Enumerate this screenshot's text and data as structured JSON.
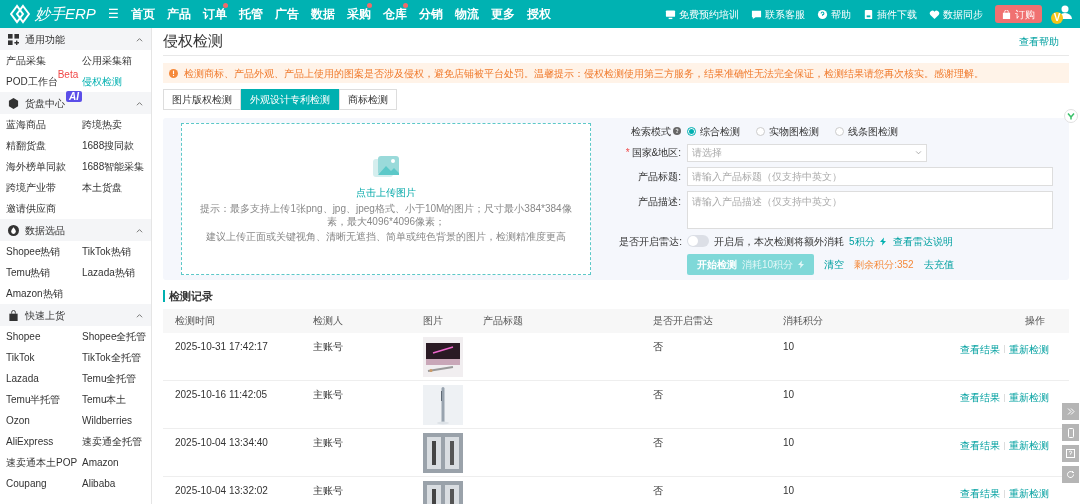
{
  "topbar": {
    "logo": "妙手ERP",
    "menu_icon": "☰",
    "nav": [
      {
        "label": "首页",
        "dot": false
      },
      {
        "label": "产品",
        "dot": false
      },
      {
        "label": "订单",
        "dot": true
      },
      {
        "label": "托管",
        "dot": false
      },
      {
        "label": "广告",
        "dot": false
      },
      {
        "label": "数据",
        "dot": false
      },
      {
        "label": "采购",
        "dot": true
      },
      {
        "label": "仓库",
        "dot": true
      },
      {
        "label": "分销",
        "dot": false
      },
      {
        "label": "物流",
        "dot": false
      },
      {
        "label": "更多",
        "dot": false
      },
      {
        "label": "授权",
        "dot": false
      }
    ],
    "actions": [
      {
        "kind": "monitor",
        "label": "免费预约培训"
      },
      {
        "kind": "chat",
        "label": "联系客服"
      },
      {
        "kind": "help",
        "label": "帮助"
      },
      {
        "kind": "download",
        "label": "插件下载"
      },
      {
        "kind": "sync",
        "label": "数据同步"
      }
    ],
    "order_button": "订购",
    "vip_badge": "V"
  },
  "sidebar": [
    {
      "kind": "grid",
      "title": "通用功能",
      "expanded": true,
      "items": [
        {
          "label": "产品采集",
          "selected": false
        },
        {
          "label": "公用采集箱",
          "selected": false
        },
        {
          "label": "POD工作台",
          "selected": false,
          "badge": "Beta"
        },
        {
          "label": "侵权检测",
          "selected": true
        }
      ]
    },
    {
      "kind": "cube",
      "title": "货盘中心",
      "badge": "AI",
      "expanded": true,
      "items": [
        {
          "label": "蓝海商品",
          "selected": false
        },
        {
          "label": "跨境热卖",
          "selected": false
        },
        {
          "label": "精翻货盘",
          "selected": false
        },
        {
          "label": "1688搜同款",
          "selected": false
        },
        {
          "label": "海外榜单同款",
          "selected": false
        },
        {
          "label": "1688智能采集",
          "selected": false
        },
        {
          "label": "跨境产业带",
          "selected": false
        },
        {
          "label": "本土货盘",
          "selected": false
        },
        {
          "label": "邀请供应商",
          "selected": false
        }
      ]
    },
    {
      "kind": "drop",
      "title": "数据选品",
      "expanded": true,
      "items": [
        {
          "label": "Shopee热销",
          "selected": false
        },
        {
          "label": "TikTok热销",
          "selected": false
        },
        {
          "label": "Temu热销",
          "selected": false
        },
        {
          "label": "Lazada热销",
          "selected": false
        },
        {
          "label": "Amazon热销",
          "selected": false
        }
      ]
    },
    {
      "kind": "bag",
      "title": "快速上货",
      "expanded": true,
      "items": [
        {
          "label": "Shopee",
          "selected": false
        },
        {
          "label": "Shopee全托管",
          "selected": false
        },
        {
          "label": "TikTok",
          "selected": false
        },
        {
          "label": "TikTok全托管",
          "selected": false
        },
        {
          "label": "Lazada",
          "selected": false
        },
        {
          "label": "Temu全托管",
          "selected": false
        },
        {
          "label": "Temu半托管",
          "selected": false
        },
        {
          "label": "Temu本土",
          "selected": false
        },
        {
          "label": "Ozon",
          "selected": false
        },
        {
          "label": "Wildberries",
          "selected": false
        },
        {
          "label": "AliExpress",
          "selected": false
        },
        {
          "label": "速卖通全托管",
          "selected": false
        },
        {
          "label": "速卖通本土POP",
          "selected": false
        },
        {
          "label": "Amazon",
          "selected": false
        },
        {
          "label": "Coupang",
          "selected": false
        },
        {
          "label": "Alibaba",
          "selected": false
        }
      ]
    }
  ],
  "page": {
    "title": "侵权检测",
    "help_link": "查看帮助",
    "alert": "检测商标、产品外观、产品上使用的图案是否涉及侵权，避免店铺被平台处罚。温馨提示：侵权检测使用第三方服务，结果准确性无法完全保证，检测结果请您再次核实。感谢理解。",
    "tabs": [
      {
        "label": "图片版权检测",
        "selected": false
      },
      {
        "label": "外观设计专利检测",
        "selected": true
      },
      {
        "label": "商标检测",
        "selected": false
      }
    ],
    "upload": {
      "label": "点击上传图片",
      "hint_lines": [
        "提示：最多支持上传1张png、jpg、jpeg格式、小于10M的图片；尺寸最小384*384像素，最大4096*4096像素；",
        "建议上传正面或关键视角、清晰无遮挡、简单或纯色背景的图片，检测精准度更高"
      ]
    },
    "form": {
      "mode_label": "检索模式",
      "modes": [
        {
          "label": "综合检测",
          "selected": true
        },
        {
          "label": "实物图检测",
          "selected": false
        },
        {
          "label": "线条图检测",
          "selected": false
        }
      ],
      "required_mark": "*",
      "country_label": "国家&地区:",
      "country_placeholder": "请选择",
      "title_label": "产品标题:",
      "title_placeholder": "请输入产品标题（仅支持中英文）",
      "desc_label": "产品描述:",
      "desc_placeholder": "请输入产品描述（仅支持中英文）",
      "radar_label": "是否开启雷达:",
      "radar_on": false,
      "radar_note": "开启后，本次检测将额外消耗",
      "radar_cost": "5积分",
      "radar_link": "查看雷达说明",
      "start_button": "开始检测",
      "start_cost": "消耗10积分",
      "clear": "清空",
      "remaining": "剩余积分:352",
      "recharge": "去充值"
    },
    "records": {
      "title": "检测记录",
      "columns": [
        "检测时间",
        "检测人",
        "图片",
        "产品标题",
        "是否开启雷达",
        "消耗积分",
        "操作"
      ],
      "rows": [
        {
          "time": "2025-10-31 17:42:17",
          "user": "主账号",
          "radar": "否",
          "points": "10",
          "actions": [
            "查看结果",
            "重新检测"
          ]
        },
        {
          "time": "2025-10-16 11:42:05",
          "user": "主账号",
          "radar": "否",
          "points": "10",
          "actions": [
            "查看结果",
            "重新检测"
          ]
        },
        {
          "time": "2025-10-04 13:34:40",
          "user": "主账号",
          "radar": "否",
          "points": "10",
          "actions": [
            "查看结果",
            "重新检测"
          ]
        },
        {
          "time": "2025-10-04 13:32:02",
          "user": "主账号",
          "radar": "否",
          "points": "10",
          "actions": [
            "查看结果",
            "重新检测"
          ]
        }
      ]
    }
  }
}
